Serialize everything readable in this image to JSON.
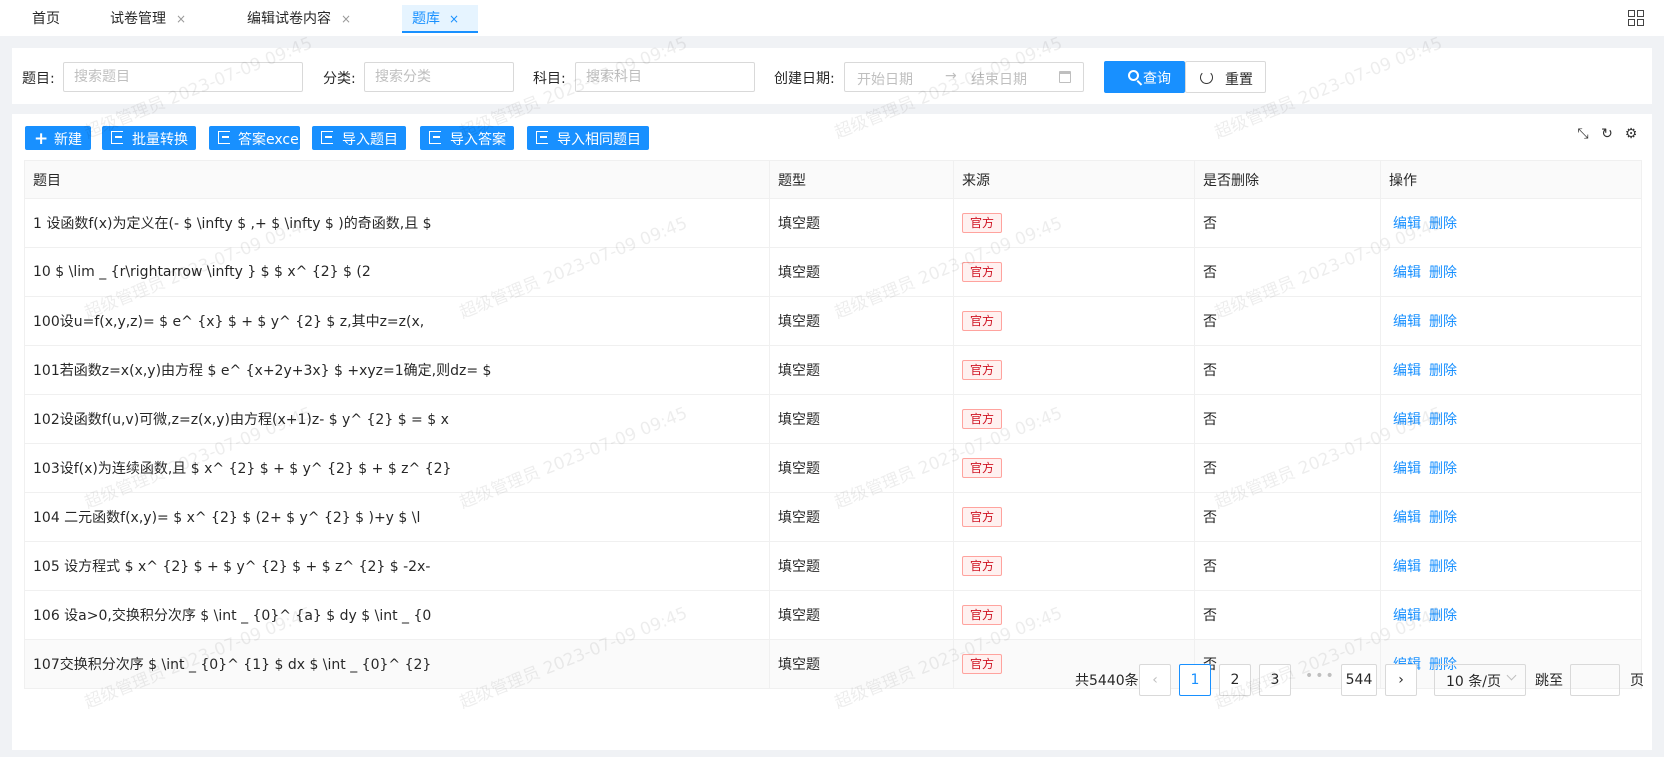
{
  "tabs": [
    {
      "label": "首页",
      "closable": false
    },
    {
      "label": "试卷管理",
      "closable": true
    },
    {
      "label": "编辑试卷内容",
      "closable": true
    },
    {
      "label": "题库",
      "closable": true,
      "active": true
    }
  ],
  "close_glyph": "×",
  "search": {
    "topic_label": "题目:",
    "topic_placeholder": "搜索题目",
    "category_label": "分类:",
    "category_placeholder": "搜索分类",
    "subject_label": "科目:",
    "subject_placeholder": "搜索科目",
    "date_label": "创建日期:",
    "start_placeholder": "开始日期",
    "end_placeholder": "结束日期",
    "query_label": "查询",
    "reset_label": "重置"
  },
  "toolbar": {
    "new_label": "新建",
    "batch_convert_label": "批量转换",
    "answer_excel_label": "答案excel",
    "import_questions_label": "导入题目",
    "import_answers_label": "导入答案",
    "import_same_label": "导入相同题目"
  },
  "table": {
    "columns": [
      "题目",
      "题型",
      "来源",
      "是否删除",
      "操作"
    ],
    "rows": [
      {
        "question": "1 设函数f(x)为定义在(- $ \\infty $ ,+ $ \\infty $ )的奇函数,且 $",
        "type": "填空题",
        "source": "官方",
        "deleted": "否"
      },
      {
        "question": "10 $ \\lim _ {r\\rightarrow \\infty } $ $ x^ {2} $ (2",
        "type": "填空题",
        "source": "官方",
        "deleted": "否"
      },
      {
        "question": "100设u=f(x,y,z)= $ e^ {x} $ + $ y^ {2} $ z,其中z=z(x,",
        "type": "填空题",
        "source": "官方",
        "deleted": "否"
      },
      {
        "question": "101若函数z=x(x,y)由方程 $ e^ {x+2y+3x} $ +xyz=1确定,则dz= $",
        "type": "填空题",
        "source": "官方",
        "deleted": "否"
      },
      {
        "question": "102设函数f(u,v)可微,z=z(x,y)由方程(x+1)z- $ y^ {2} $ = $ x",
        "type": "填空题",
        "source": "官方",
        "deleted": "否"
      },
      {
        "question": "103设f(x)为连续函数,且 $ x^ {2} $ + $ y^ {2} $ + $ z^ {2}",
        "type": "填空题",
        "source": "官方",
        "deleted": "否"
      },
      {
        "question": "104 二元函数f(x,y)= $ x^ {2} $ (2+ $ y^ {2} $ )+y $ \\l",
        "type": "填空题",
        "source": "官方",
        "deleted": "否"
      },
      {
        "question": "105 设方程式 $ x^ {2} $ + $ y^ {2} $ + $ z^ {2} $ -2x-",
        "type": "填空题",
        "source": "官方",
        "deleted": "否"
      },
      {
        "question": "106 设a>0,交换积分次序 $ \\int _ {0}^ {a} $ dy $ \\int _ {0",
        "type": "填空题",
        "source": "官方",
        "deleted": "否"
      },
      {
        "question": "107交换积分次序 $ \\int _ {0}^ {1} $ dx $ \\int _ {0}^ {2}",
        "type": "填空题",
        "source": "官方",
        "deleted": "否"
      }
    ],
    "edit_label": "编辑",
    "delete_label": "删除"
  },
  "pagination": {
    "total": "共5440条",
    "pages": [
      "1",
      "2",
      "3"
    ],
    "ellipsis": "•••",
    "last": "544",
    "prev": "‹",
    "next": "›",
    "current": "1",
    "page_size": "10 条/页",
    "jump_label": "跳至",
    "page_suffix": "页"
  },
  "watermark": "超级管理员 2023-07-09 09:45",
  "colors": {
    "primary": "#1890ff",
    "tag_red": "#cf1322"
  }
}
